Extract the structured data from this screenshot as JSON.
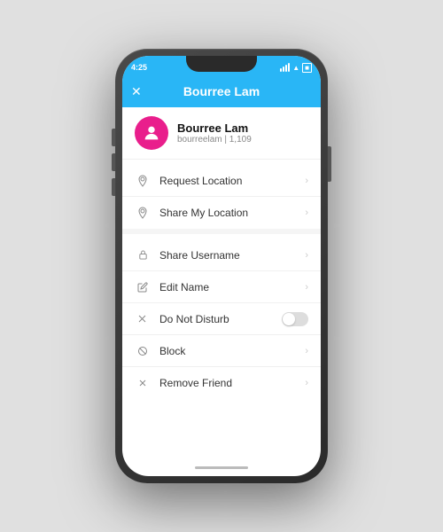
{
  "statusBar": {
    "time": "4:25",
    "signal": true,
    "wifi": true,
    "battery": true
  },
  "header": {
    "title": "Bourree Lam",
    "closeLabel": "✕"
  },
  "profile": {
    "name": "Bourree Lam",
    "username": "bourreelam",
    "score": "1,109"
  },
  "menuSections": [
    {
      "items": [
        {
          "id": "request-location",
          "icon": "📍",
          "label": "Request Location",
          "type": "chevron"
        },
        {
          "id": "share-my-location",
          "icon": "📍",
          "label": "Share My Location",
          "type": "chevron"
        }
      ]
    },
    {
      "items": [
        {
          "id": "share-username",
          "icon": "🔒",
          "label": "Share Username",
          "type": "chevron"
        },
        {
          "id": "edit-name",
          "icon": "✏️",
          "label": "Edit Name",
          "type": "chevron"
        },
        {
          "id": "do-not-disturb",
          "icon": "🔀",
          "label": "Do Not Disturb",
          "type": "toggle"
        },
        {
          "id": "block",
          "icon": "⊘",
          "label": "Block",
          "type": "chevron"
        },
        {
          "id": "remove-friend",
          "icon": "✕",
          "label": "Remove Friend",
          "type": "chevron"
        }
      ]
    }
  ]
}
